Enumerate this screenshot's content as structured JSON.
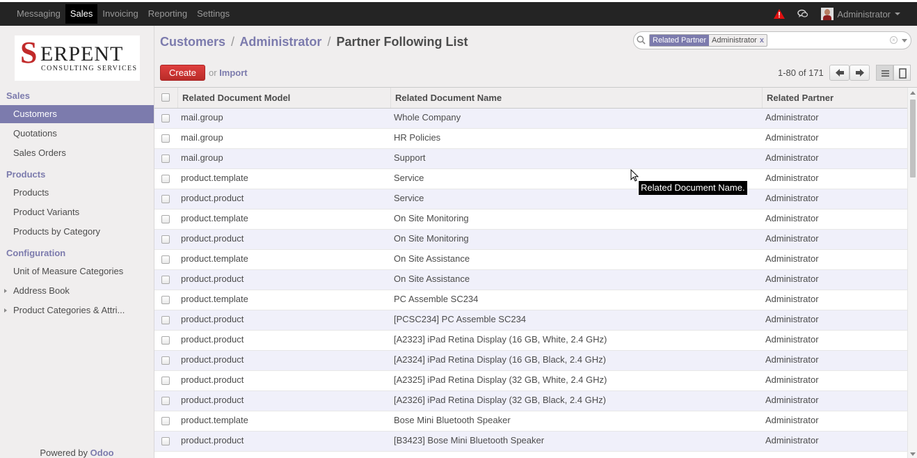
{
  "topmenu": {
    "items": [
      {
        "label": "Messaging",
        "active": false
      },
      {
        "label": "Sales",
        "active": true
      },
      {
        "label": "Invoicing",
        "active": false
      },
      {
        "label": "Reporting",
        "active": false
      },
      {
        "label": "Settings",
        "active": false
      }
    ],
    "user_name": "Administrator",
    "icons": {
      "alert": "warning-icon",
      "chat": "chat-icon"
    }
  },
  "sidebar": {
    "logo_text": {
      "letter": "S",
      "rest": "ERPENT",
      "sub": "CONSULTING SERVICES"
    },
    "sections": [
      {
        "title": "Sales",
        "items": [
          "Customers",
          "Quotations",
          "Sales Orders"
        ]
      },
      {
        "title": "Products",
        "items": [
          "Products",
          "Product Variants",
          "Products by Category"
        ]
      },
      {
        "title": "Configuration",
        "items": [
          "Unit of Measure Categories",
          "Address Book",
          "Product Categories & Attri..."
        ]
      }
    ],
    "active_item": "Customers",
    "powered_by": "Powered by",
    "powered_brand": "Odoo"
  },
  "breadcrumb": {
    "items": [
      "Customers",
      "Administrator"
    ],
    "current": "Partner Following List",
    "separator": "/"
  },
  "search": {
    "facet_category": "Related Partner",
    "facet_value": "Administrator",
    "facet_remove": "x"
  },
  "toolbar": {
    "create_label": "Create",
    "or_label": "or",
    "import_label": "Import",
    "pager": "1-80 of 171"
  },
  "table": {
    "columns": [
      "Related Document Model",
      "Related Document Name",
      "Related Partner"
    ],
    "rows": [
      [
        "mail.group",
        "Whole Company",
        "Administrator"
      ],
      [
        "mail.group",
        "HR Policies",
        "Administrator"
      ],
      [
        "mail.group",
        "Support",
        "Administrator"
      ],
      [
        "product.template",
        "Service",
        "Administrator"
      ],
      [
        "product.product",
        "Service",
        "Administrator"
      ],
      [
        "product.template",
        "On Site Monitoring",
        "Administrator"
      ],
      [
        "product.product",
        "On Site Monitoring",
        "Administrator"
      ],
      [
        "product.template",
        "On Site Assistance",
        "Administrator"
      ],
      [
        "product.product",
        "On Site Assistance",
        "Administrator"
      ],
      [
        "product.template",
        "PC Assemble SC234",
        "Administrator"
      ],
      [
        "product.product",
        "[PCSC234] PC Assemble SC234",
        "Administrator"
      ],
      [
        "product.product",
        "[A2323] iPad Retina Display (16 GB, White, 2.4 GHz)",
        "Administrator"
      ],
      [
        "product.product",
        "[A2324] iPad Retina Display (16 GB, Black, 2.4 GHz)",
        "Administrator"
      ],
      [
        "product.product",
        "[A2325] iPad Retina Display (32 GB, White, 2.4 GHz)",
        "Administrator"
      ],
      [
        "product.product",
        "[A2326] iPad Retina Display (32 GB, Black, 2.4 GHz)",
        "Administrator"
      ],
      [
        "product.template",
        "Bose Mini Bluetooth Speaker",
        "Administrator"
      ],
      [
        "product.product",
        "[B3423] Bose Mini Bluetooth Speaker",
        "Administrator"
      ]
    ]
  },
  "tooltip": "Related Document Name.",
  "colors": {
    "accent": "#7c7bad",
    "topbar": "#242424",
    "create": "#c12a2a"
  }
}
